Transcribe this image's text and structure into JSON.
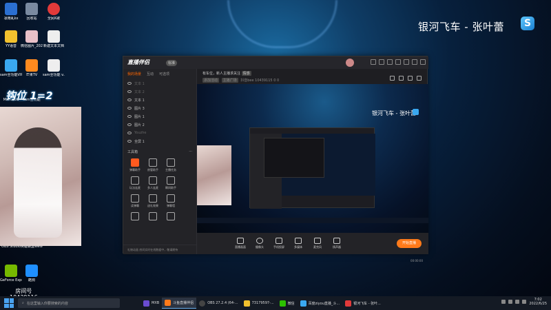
{
  "desktop": {
    "song_title": "银河飞车 - 张叶蕾",
    "logo_letter": "S",
    "overlay_text": "钩位 1=2",
    "overlay_text_small": "钩位 1=2",
    "host_label": "房间号",
    "host_id": "10439116",
    "icons": [
      {
        "label": "凛雨乱kx"
      },
      {
        "label": "回收站"
      },
      {
        "label": "全民K歌"
      },
      {
        "label": "YY语音"
      },
      {
        "label": "微信图片_2022061..."
      },
      {
        "label": "新建文本文档"
      },
      {
        "label": "sam全功能VIP"
      },
      {
        "label": "芒果TV"
      },
      {
        "label": "sam全功能 v..."
      },
      {
        "label": "Microsoft"
      },
      {
        "label": "sam全功能"
      },
      {
        "label": "OBS Studio"
      },
      {
        "label": "英雄联盟WeGame版"
      },
      {
        "label": "GeForce Experience"
      },
      {
        "label": "酷狗"
      }
    ]
  },
  "app": {
    "brand": "直播伴侣",
    "brand_badge": "标准",
    "left_tabs": [
      "我的场景",
      "互动",
      "可选项"
    ],
    "sources": [
      {
        "name": "文本 1",
        "dim": true
      },
      {
        "name": "文本 2",
        "dim": true
      },
      {
        "name": "文本 1",
        "dim": false
      },
      {
        "name": "图片 3",
        "dim": false
      },
      {
        "name": "图片 1",
        "dim": false
      },
      {
        "name": "图片 2",
        "dim": false
      },
      {
        "name": "Youzhe",
        "dim": true
      },
      {
        "name": "全屏 1",
        "dim": false
      }
    ],
    "tools_title": "工具箱",
    "tools": [
      {
        "label": "弹幕助手",
        "hot": true
      },
      {
        "label": "房管助手",
        "hot": false
      },
      {
        "label": "主播任务",
        "hot": false
      },
      {
        "label": "",
        "hot": false
      },
      {
        "label": "玩法连麦",
        "hot": false
      },
      {
        "label": "多人连麦",
        "hot": false
      },
      {
        "label": "瞬间助手",
        "hot": false
      },
      {
        "label": "",
        "hot": false
      },
      {
        "label": "读弹幕",
        "hot": false
      },
      {
        "label": "送礼效果",
        "hot": false
      },
      {
        "label": "弹幕墙",
        "hot": false
      },
      {
        "label": "",
        "hot": false
      },
      {
        "label": "",
        "hot": false
      },
      {
        "label": "",
        "hot": false
      },
      {
        "label": "",
        "hot": false
      },
      {
        "label": "",
        "hot": false
      }
    ],
    "footer_text": "礼物动画  房间实时在线数据中，敬请期待",
    "header_line1": "有车位，新人主播求关注",
    "header_tag": "情感",
    "header_tags": [
      "添加活动",
      "主播广场"
    ],
    "header_id": "抖音bee 10439115",
    "header_count1": "0",
    "header_count2": "0",
    "preview_title": "银河飞车 - 张叶蕾",
    "controls": [
      {
        "label": "直播画面"
      },
      {
        "label": "摄像头"
      },
      {
        "label": "手机投屏"
      },
      {
        "label": "多媒体"
      },
      {
        "label": "麦克风"
      },
      {
        "label": "扬声器"
      }
    ],
    "go_live": "开始直播",
    "status_time": "00:00:00"
  },
  "taskbar": {
    "search_placeholder": "在这里输入你要搜索的内容",
    "items": [
      {
        "label": "MXB",
        "active": false
      },
      {
        "label": "斗鱼直播伴侣",
        "active": true
      },
      {
        "label": "OBS 27.2.4 (64-...",
        "active": false
      },
      {
        "label": "73179597-...",
        "active": false
      },
      {
        "label": "微信",
        "active": false
      },
      {
        "label": "百度ziyou直播_斗...",
        "active": false
      },
      {
        "label": "银河飞车 - 张叶...",
        "active": false
      }
    ],
    "time": "7:02",
    "date": "2022/6/25"
  },
  "colors": {
    "accent": "#ff7a1a",
    "hot_tool": "#ff5a1f",
    "logo_blue": "#3aa8f0"
  }
}
